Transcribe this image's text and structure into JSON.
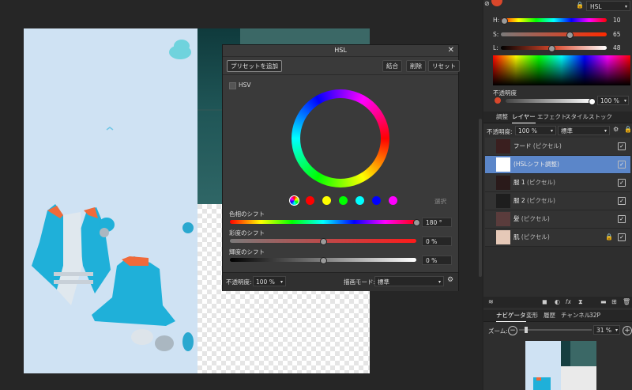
{
  "colors": {
    "accent": "#5b86c9",
    "swatch_red": "#d9472b",
    "hue_swatches": [
      "#ff0000",
      "#ffff00",
      "#00ff00",
      "#00ffff",
      "#0000ff",
      "#ff00ff"
    ]
  },
  "hsl_dialog": {
    "title": "HSL",
    "add_preset": "プリセットを追加",
    "merge": "結合",
    "delete": "削除",
    "reset": "リセット",
    "hsv_label": "HSV",
    "select_label": "選択",
    "hue_shift_label": "色相のシフト",
    "hue_shift_value": "180 °",
    "hue_shift": 180,
    "saturation_shift_label": "彩度のシフト",
    "saturation_shift_value": "0 %",
    "saturation_shift": 0,
    "lightness_shift_label": "輝度のシフト",
    "lightness_shift_value": "0 %",
    "lightness_shift": 0,
    "opacity_label": "不透明度:",
    "opacity_value": "100 %",
    "blend_mode_label": "描画モード:",
    "blend_mode_value": "標準"
  },
  "color_panel": {
    "mode": "HSL",
    "h_label": "H:",
    "h_value": "10",
    "h": 10,
    "s_label": "S:",
    "s_value": "65",
    "s": 65,
    "l_label": "L:",
    "l_value": "48",
    "l": 48,
    "opacity_label": "不透明度",
    "opacity_value": "100 %"
  },
  "layers_panel": {
    "tabs": [
      "調整",
      "レイヤー",
      "エフェクト",
      "スタイル",
      "ストック"
    ],
    "opacity_label": "不透明度:",
    "opacity_value": "100 %",
    "blend_value": "標準",
    "layers": [
      {
        "name": "フード",
        "type": "(ピクセル)"
      },
      {
        "name": "(HSLシフト調整)",
        "type": ""
      },
      {
        "name": "服 1",
        "type": "(ピクセル)"
      },
      {
        "name": "服 2",
        "type": "(ピクセル)"
      },
      {
        "name": "髪",
        "type": "(ピクセル)"
      },
      {
        "name": "肌",
        "type": "(ピクセル)"
      }
    ]
  },
  "navigator_panel": {
    "tabs": [
      "ナビゲータ",
      "変形",
      "履歴",
      "チャンネル",
      "32P"
    ],
    "zoom_label": "ズーム:",
    "zoom_value": "31 %"
  }
}
